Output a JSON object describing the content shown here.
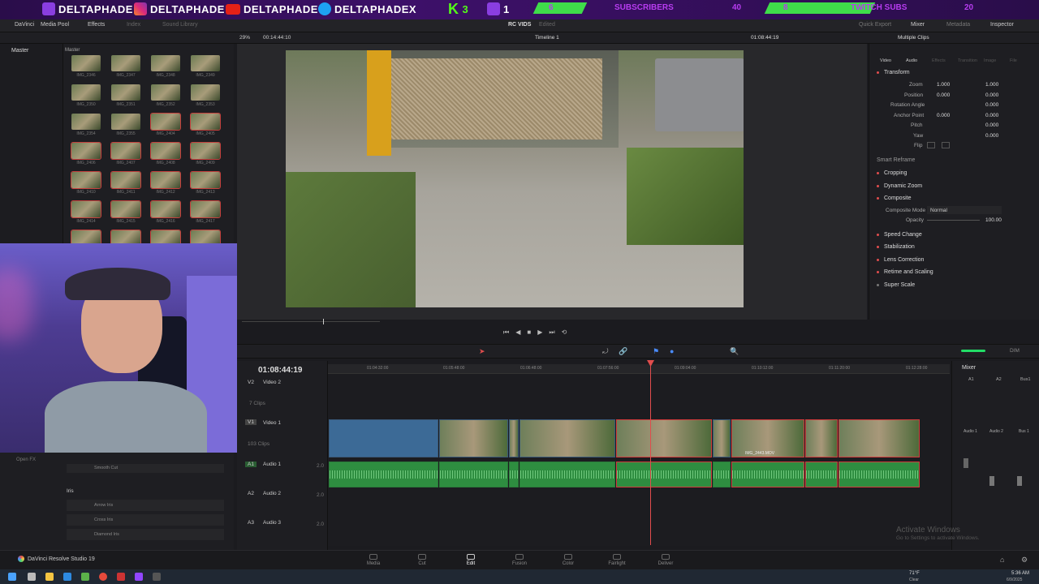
{
  "banner": {
    "handles": [
      "DELTAPHADE",
      "DELTAPHADE",
      "DELTAPHADE",
      "DELTAPHADEX"
    ],
    "kick_count": "3",
    "twitch_count": "1",
    "subs_current": "6",
    "subs_label": "SUBSCRIBERS",
    "subs_goal": "40",
    "twitch_subs_current": "8",
    "twitch_subs_label": "TWITCH SUBS",
    "twitch_subs_goal": "20"
  },
  "menubar": {
    "app_short": "DaVinci",
    "media_pool": "Media Pool",
    "effects": "Effects",
    "index": "Index",
    "sound_library": "Sound Library",
    "project_name": "RC VIDS",
    "edited": "Edited",
    "quick_export": "Quick Export",
    "mixer": "Mixer",
    "metadata": "Metadata",
    "inspector": "Inspector"
  },
  "viewer_bar": {
    "zoom": "29%",
    "timecode_src": "00:14:44:10",
    "timeline_name": "Timeline 1",
    "timecode_rec": "01:08:44:19",
    "multiple_clips": "Multiple Clips"
  },
  "media_pool": {
    "bin": "Master",
    "bin2": "Master",
    "clips": [
      "IMG_2346",
      "IMG_2347",
      "IMG_2348",
      "IMG_2349",
      "IMG_2350",
      "IMG_2351",
      "IMG_2352",
      "IMG_2353",
      "IMG_2354",
      "IMG_2355",
      "IMG_2404",
      "IMG_2405",
      "IMG_2406",
      "IMG_2407",
      "IMG_2408",
      "IMG_2409",
      "IMG_2410",
      "IMG_2411",
      "IMG_2412",
      "IMG_2413",
      "IMG_2414",
      "IMG_2415",
      "IMG_2416",
      "IMG_2417",
      "IMG_2418",
      "IMG_2419",
      "IMG_2420",
      "IMG_2421"
    ]
  },
  "effects_panel": {
    "open_fx": "Open FX",
    "smooth_cut": "Smooth Cut",
    "iris_header": "Iris",
    "items": [
      "Arrow Iris",
      "Cross Iris",
      "Diamond Iris"
    ]
  },
  "inspector": {
    "tabs": [
      "Video",
      "Audio",
      "Effects",
      "Transition",
      "Image",
      "File"
    ],
    "transform": "Transform",
    "zoom_label": "Zoom",
    "zoom_x": "1.000",
    "zoom_y": "1.000",
    "position_label": "Position",
    "position_x": "0.000",
    "position_y": "0.000",
    "rotation_label": "Rotation Angle",
    "rotation": "0.000",
    "anchor_label": "Anchor Point",
    "anchor_x": "0.000",
    "anchor_y": "0.000",
    "pitch_label": "Pitch",
    "pitch": "0.000",
    "yaw_label": "Yaw",
    "yaw": "0.000",
    "flip_label": "Flip",
    "smart_reframe": "Smart Reframe",
    "cropping": "Cropping",
    "dynamic_zoom": "Dynamic Zoom",
    "composite": "Composite",
    "composite_mode_label": "Composite Mode",
    "composite_mode": "Normal",
    "opacity_label": "Opacity",
    "opacity": "100.00",
    "speed_change": "Speed Change",
    "stabilization": "Stabilization",
    "lens_correction": "Lens Correction",
    "retime_scaling": "Retime and Scaling",
    "super_scale": "Super Scale"
  },
  "timeline": {
    "timecode": "01:08:44:19",
    "ruler": [
      "01:04:32:00",
      "01:05:48:00",
      "01:06:48:00",
      "01:07:56:00",
      "01:09:04:00",
      "01:10:12:00",
      "01:11:20:00",
      "01:12:28:00"
    ],
    "v2_id": "V2",
    "v2_name": "Video 2",
    "v2_clips": "7 Clips",
    "v1_id": "V1",
    "v1_name": "Video 1",
    "v1_clips": "103 Clips",
    "a1_id": "A1",
    "a1_name": "Audio 1",
    "a1_level": "2.0",
    "a2_id": "A2",
    "a2_name": "Audio 2",
    "a2_level": "2.0",
    "a3_id": "A3",
    "a3_name": "Audio 3",
    "a3_level": "2.0",
    "clip_labels": [
      "IMG_2443.MOV",
      "IMG_2...",
      "IMG_24..."
    ]
  },
  "mixer": {
    "title": "Mixer",
    "ch": [
      "A1",
      "A2",
      "Bus1"
    ],
    "strip": [
      "Audio 1",
      "Audio 2",
      "Bus 1"
    ],
    "dim": "DIM"
  },
  "pages": [
    "Media",
    "Cut",
    "Edit",
    "Fusion",
    "Color",
    "Fairlight",
    "Deliver"
  ],
  "active_page": "Edit",
  "footer": {
    "product": "DaVinci Resolve Studio 19",
    "activate_title": "Activate Windows",
    "activate_sub": "Go to Settings to activate Windows."
  },
  "taskbar": {
    "weather": "71°F",
    "weather_sub": "Clear",
    "time": "5:36 AM",
    "date": "6/9/2025"
  }
}
